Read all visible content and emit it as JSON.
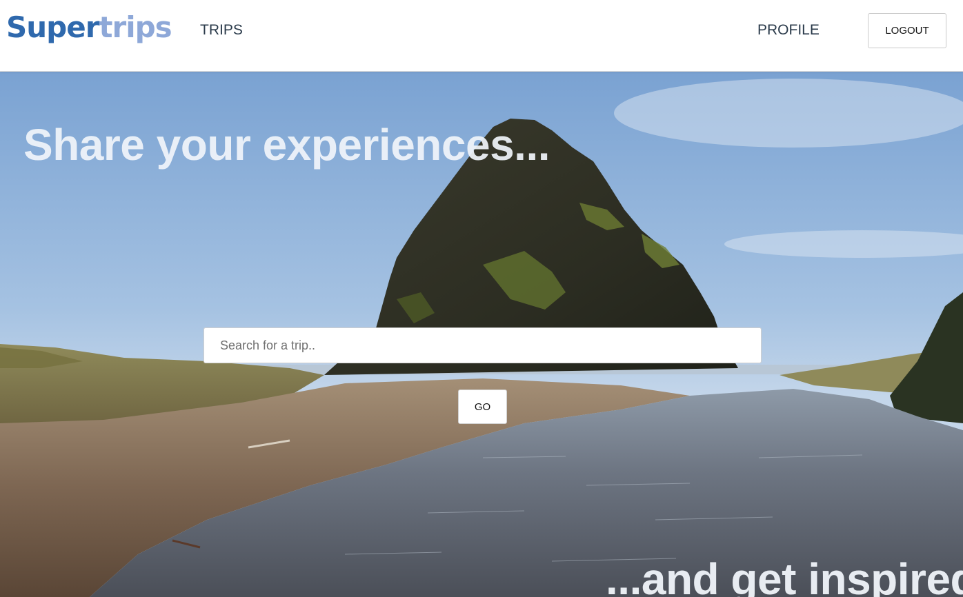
{
  "brand": {
    "logo_part_a": "Super",
    "logo_part_b": "trips",
    "color_a": "#2f69ad",
    "color_b": "#8ea8d8"
  },
  "nav": {
    "trips_label": "TRIPS",
    "profile_label": "PROFILE",
    "logout_label": "LOGOUT"
  },
  "hero": {
    "title": "Share your experiences...",
    "tagline": "...and get inspired",
    "background_image": "coastal-rock-beach-photo"
  },
  "search": {
    "placeholder": "Search for a trip..",
    "value": "",
    "go_label": "GO"
  }
}
